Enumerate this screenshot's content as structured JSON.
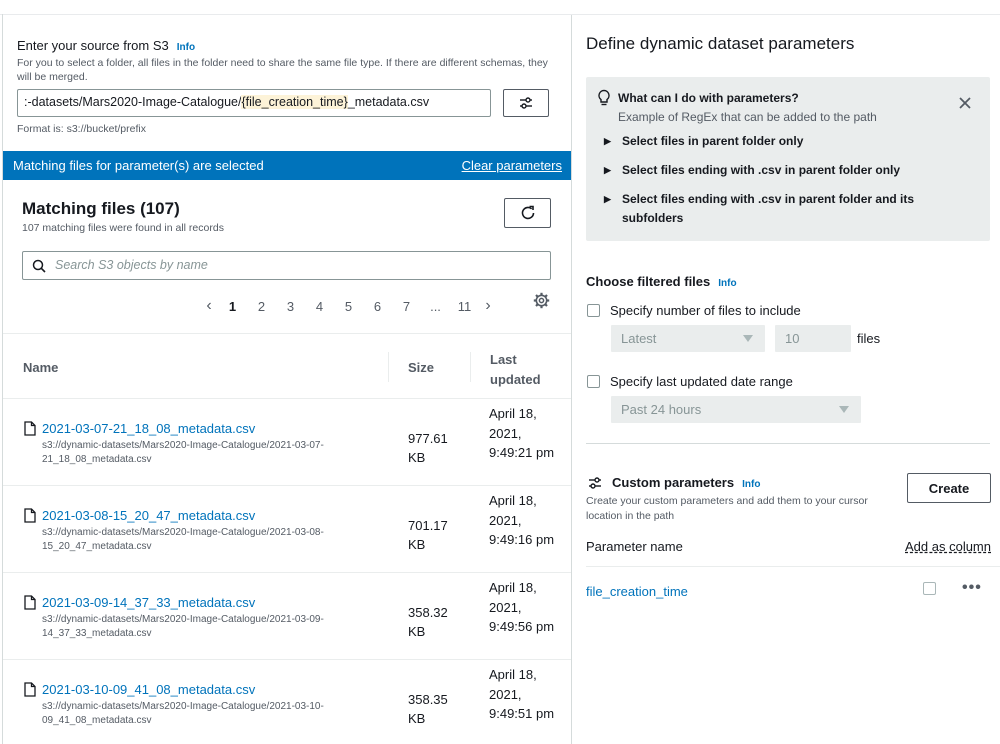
{
  "source": {
    "title": "Enter your source from S3",
    "info": "Info",
    "description": "For you to select a folder, all files in the folder need to share the same file type. If there are different schemas, they will be merged.",
    "path_prefix": ":-datasets/Mars2020-Image-Catalogue/",
    "path_param": "{file_creation_time}",
    "path_suffix": "_metadata.csv",
    "format_hint": "Format is: s3://bucket/prefix"
  },
  "banner": {
    "text": "Matching files for parameter(s) are selected",
    "clear": "Clear parameters"
  },
  "matching": {
    "title": "Matching files (107)",
    "subtitle": "107 matching files were found in all records",
    "search_placeholder": "Search S3 objects by name"
  },
  "pagination": {
    "pages": [
      "1",
      "2",
      "3",
      "4",
      "5",
      "6",
      "7",
      "...",
      "11"
    ],
    "current": "1"
  },
  "table": {
    "headers": {
      "name": "Name",
      "size": "Size",
      "last_updated": "Last updated"
    },
    "rows": [
      {
        "name": "2021-03-07-21_18_08_metadata.csv",
        "path": "s3://dynamic-datasets/Mars2020-Image-Catalogue/2021-03-07-21_18_08_metadata.csv",
        "size": "977.61 KB",
        "updated": "April 18, 2021, 9:49:21 pm"
      },
      {
        "name": "2021-03-08-15_20_47_metadata.csv",
        "path": "s3://dynamic-datasets/Mars2020-Image-Catalogue/2021-03-08-15_20_47_metadata.csv",
        "size": "701.17 KB",
        "updated": "April 18, 2021, 9:49:16 pm"
      },
      {
        "name": "2021-03-09-14_37_33_metadata.csv",
        "path": "s3://dynamic-datasets/Mars2020-Image-Catalogue/2021-03-09-14_37_33_metadata.csv",
        "size": "358.32 KB",
        "updated": "April 18, 2021, 9:49:56 pm"
      },
      {
        "name": "2021-03-10-09_41_08_metadata.csv",
        "path": "s3://dynamic-datasets/Mars2020-Image-Catalogue/2021-03-10-09_41_08_metadata.csv",
        "size": "358.35 KB",
        "updated": "April 18, 2021, 9:49:51 pm"
      }
    ]
  },
  "right": {
    "title": "Define dynamic dataset parameters",
    "help": {
      "question": "What can I do with parameters?",
      "subtitle": "Example of RegEx that can be added to the path",
      "items": [
        "Select files in parent folder only",
        "Select files ending with .csv in parent folder only",
        "Select files ending with .csv in parent folder and its subfolders"
      ]
    },
    "filtered": {
      "title": "Choose filtered files",
      "info": "Info",
      "count_label": "Specify number of files to include",
      "count_select": "Latest",
      "count_value": "10",
      "count_unit": "files",
      "date_label": "Specify last updated date range",
      "date_select": "Past 24 hours"
    },
    "custom": {
      "title": "Custom parameters",
      "info": "Info",
      "description": "Create your custom parameters and add them to your cursor location in the path",
      "create": "Create",
      "param_name_label": "Parameter name",
      "add_as_column": "Add as column",
      "params": [
        "file_creation_time"
      ]
    }
  }
}
